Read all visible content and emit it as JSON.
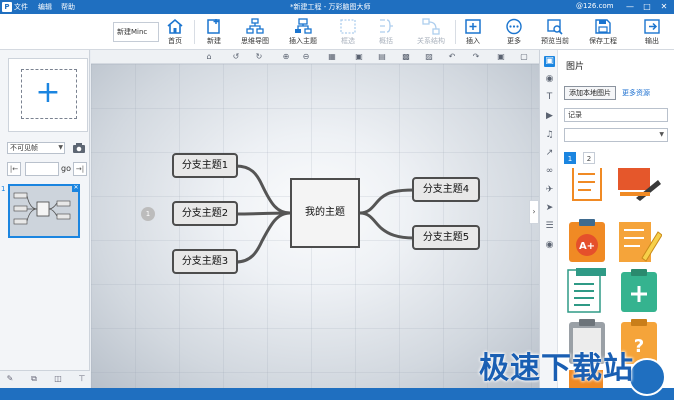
{
  "titlebar": {
    "app_icon": "P",
    "menus": [
      "文件",
      "编辑",
      "帮助"
    ],
    "title": "*新建工程 - 万彩脑图大师",
    "account": "@126.com"
  },
  "toolbar": {
    "file_tab": "新建Minc",
    "buttons": [
      {
        "label": "首页",
        "icon": "home-icon"
      },
      {
        "label": "新建",
        "icon": "new-file-icon"
      },
      {
        "label": "思维导图",
        "icon": "mindmap-icon"
      },
      {
        "label": "插入主题",
        "icon": "insert-topic-icon"
      },
      {
        "label": "框选",
        "icon": "select-box-icon"
      },
      {
        "label": "概括",
        "icon": "summary-icon"
      },
      {
        "label": "关系结构",
        "icon": "relation-icon"
      },
      {
        "label": "插入",
        "icon": "insert-icon"
      },
      {
        "label": "更多",
        "icon": "more-icon"
      },
      {
        "label": "预览当前",
        "icon": "preview-icon"
      },
      {
        "label": "保存工程",
        "icon": "save-icon"
      },
      {
        "label": "输出",
        "icon": "export-icon"
      }
    ]
  },
  "leftpanel": {
    "visibility_select": "不可见帧",
    "go_label": "go",
    "thumb_number": "1"
  },
  "mindmap": {
    "central": "我的主题",
    "left_topics": [
      "分支主题1",
      "分支主题2",
      "分支主题3"
    ],
    "right_topics": [
      "分支主题4",
      "分支主题5"
    ],
    "pin_number": "1"
  },
  "rightpanel": {
    "title": "图片",
    "add_local_button": "添加本地图片",
    "more_resources_link": "更多资源",
    "search_value": "记录",
    "pages": [
      "1",
      "2"
    ]
  },
  "colors": {
    "accent": "#1f6fc0",
    "topic_border": "#4d4d4d",
    "branch_line": "#555555"
  },
  "watermark": "极速下载站"
}
